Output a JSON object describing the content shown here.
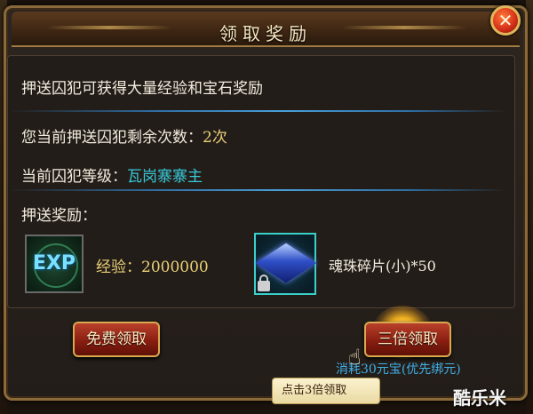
{
  "dialog": {
    "title": "领取奖励",
    "close_symbol": "✕"
  },
  "info": {
    "description": "押送囚犯可获得大量经验和宝石奖励",
    "remaining_label": "您当前押送囚犯剩余次数：",
    "remaining_value": "2次",
    "level_label": "当前囚犯等级：",
    "level_value": "瓦岗寨寨主",
    "reward_label": "押送奖励："
  },
  "rewards": [
    {
      "icon": "exp-icon",
      "icon_text": "EXP",
      "label": "经验：",
      "value": "2000000"
    },
    {
      "icon": "gem-icon",
      "label": "魂珠碎片(小)*50"
    }
  ],
  "buttons": {
    "free_label": "免费领取",
    "triple_label": "三倍领取",
    "triple_cost": "消耗30元宝(优先绑元)"
  },
  "tooltip": {
    "text": "点击3倍领取"
  },
  "watermark": "酷乐米",
  "colors": {
    "frame_gold": "#8a6a3a",
    "text_light": "#f2ecde",
    "value_yellow": "#ead078",
    "value_cyan": "#38c8d8",
    "button_red": "#8a1e12",
    "cost_blue": "#3fb0e8"
  }
}
